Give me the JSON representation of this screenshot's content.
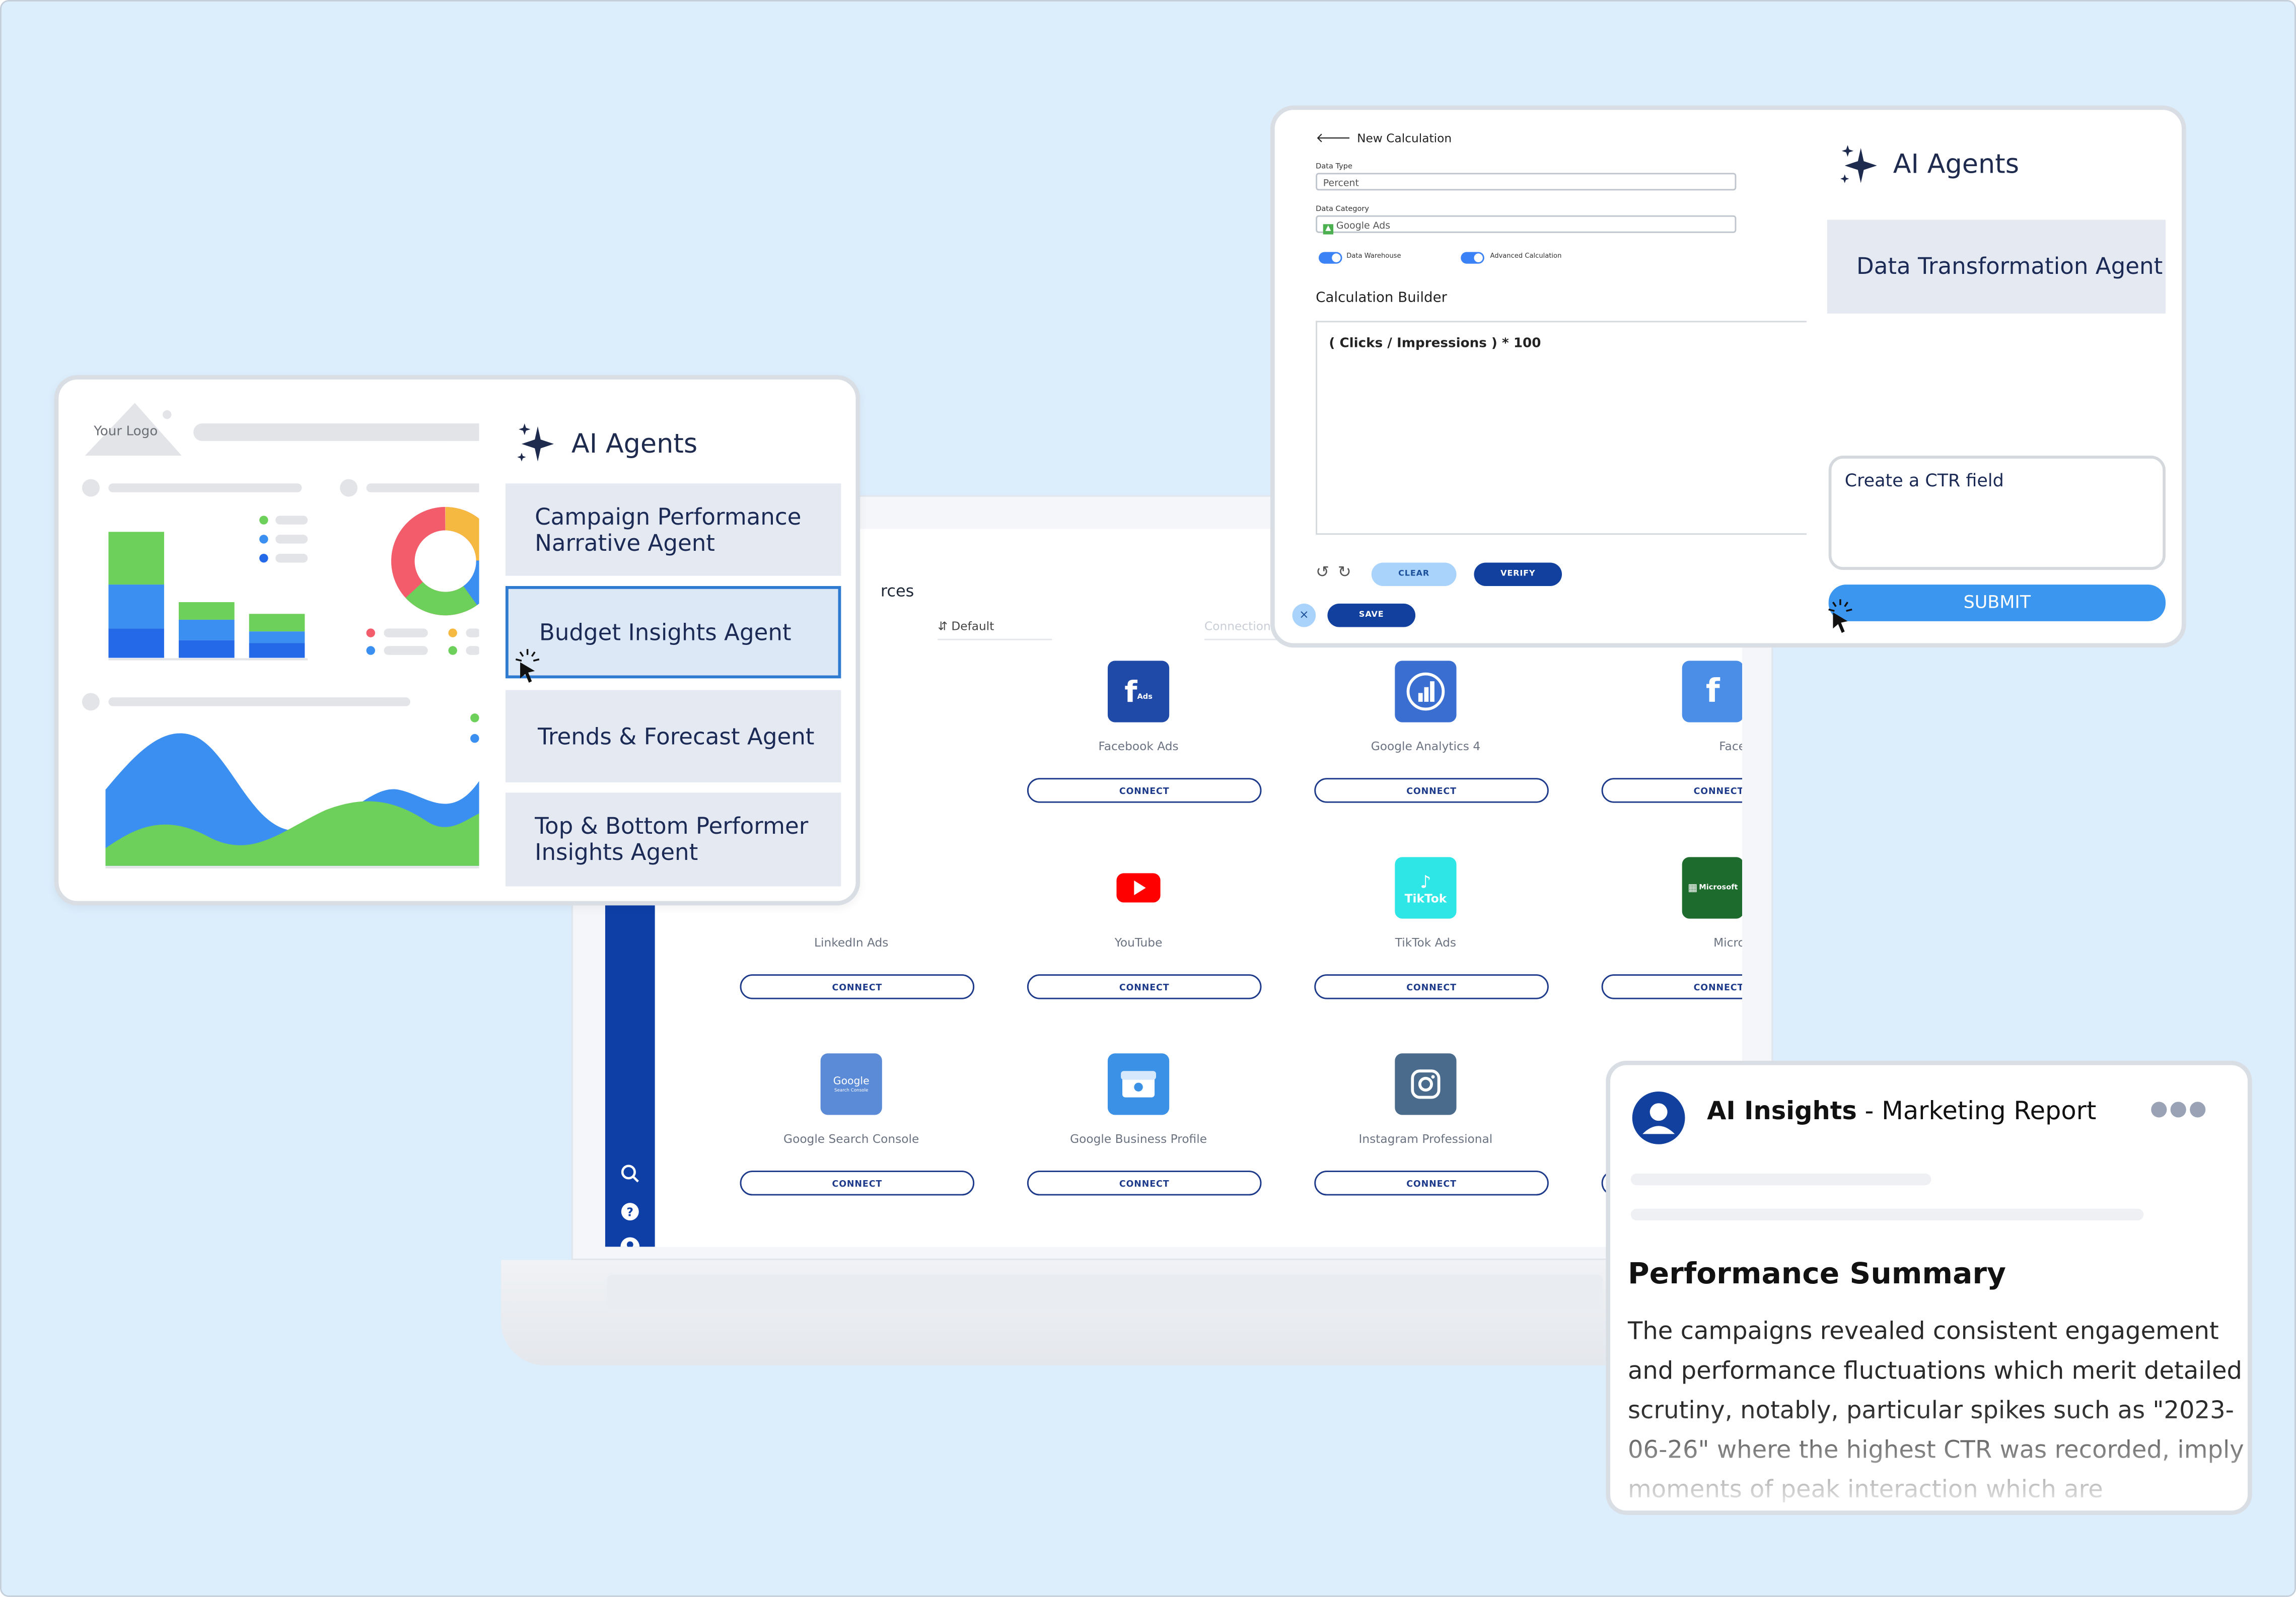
{
  "dashboard": {
    "logo_text": "Your Logo",
    "agents_title": "AI Agents",
    "agents": [
      "Campaign Performance Narrative Agent",
      "Budget Insights Agent",
      "Trends & Forecast Agent",
      "Top & Bottom Performer Insights Agent"
    ],
    "selected_agent": "Budget Insights Agent"
  },
  "calculation": {
    "back_label": "New Calculation",
    "data_type_label": "Data Type",
    "data_type_value": "Percent",
    "data_category_label": "Data Category",
    "data_category_value": "Google Ads",
    "toggle_warehouse": "Data Warehouse",
    "toggle_advanced": "Advanced Calculation",
    "builder_label": "Calculation Builder",
    "formula": "( Clicks / Impressions ) * 100",
    "clear_label": "CLEAR",
    "verify_label": "VERIFY",
    "save_label": "SAVE",
    "close_glyph": "×",
    "agents_title": "AI Agents",
    "agent_name": "Data Transformation Agent",
    "prompt_text": "Create a CTR field",
    "submit_label": "SUBMIT"
  },
  "sources": {
    "title_fragment": "rces",
    "filter_default": "Default",
    "filter_connection": "Connection",
    "connect_label": "CONNECT",
    "tiles": [
      {
        "name": "Facebook Ads",
        "color": "#1f4aa8"
      },
      {
        "name": "Google Analytics 4",
        "color": "#3a6fd1"
      },
      {
        "name": "Facebook Insights",
        "color": "#4a8ee8"
      },
      {
        "name": "LinkedIn Ads",
        "color": "#0a66c2"
      },
      {
        "name": "YouTube",
        "color": "#ff0000"
      },
      {
        "name": "TikTok Ads",
        "color": "#2ee6e6"
      },
      {
        "name": "Microsoft Advertisin",
        "color": "#1e6b2e"
      },
      {
        "name": "Google Search Console",
        "color": "#5b8bd6"
      },
      {
        "name": "Google Business Profile",
        "color": "#3b91e6"
      },
      {
        "name": "Instagram Professional",
        "color": "#4a6b8c"
      }
    ],
    "logo_text": {
      "facebook_ads": "f",
      "facebook_ads_sub": "Ads",
      "facebook_insights": "f",
      "tiktok": "TikTok",
      "microsoft": "Microsoft",
      "gsc": "Google",
      "gsc_sub": "Search Console"
    }
  },
  "insights": {
    "title_bold": "AI Insights",
    "title_rest": " - Marketing Report",
    "summary_heading": "Performance Summary",
    "summary_text": "The campaigns revealed consistent engagement and performance fluctuations which merit detailed scrutiny, notably, particular spikes such as \"2023-06-26\" where the highest CTR was recorded, imply moments of peak interaction which are"
  },
  "colors": {
    "background": "#dcedfc",
    "sidebar": "#0d3fa6",
    "accent": "#3b96f0",
    "navy_text": "#1b2a55"
  }
}
